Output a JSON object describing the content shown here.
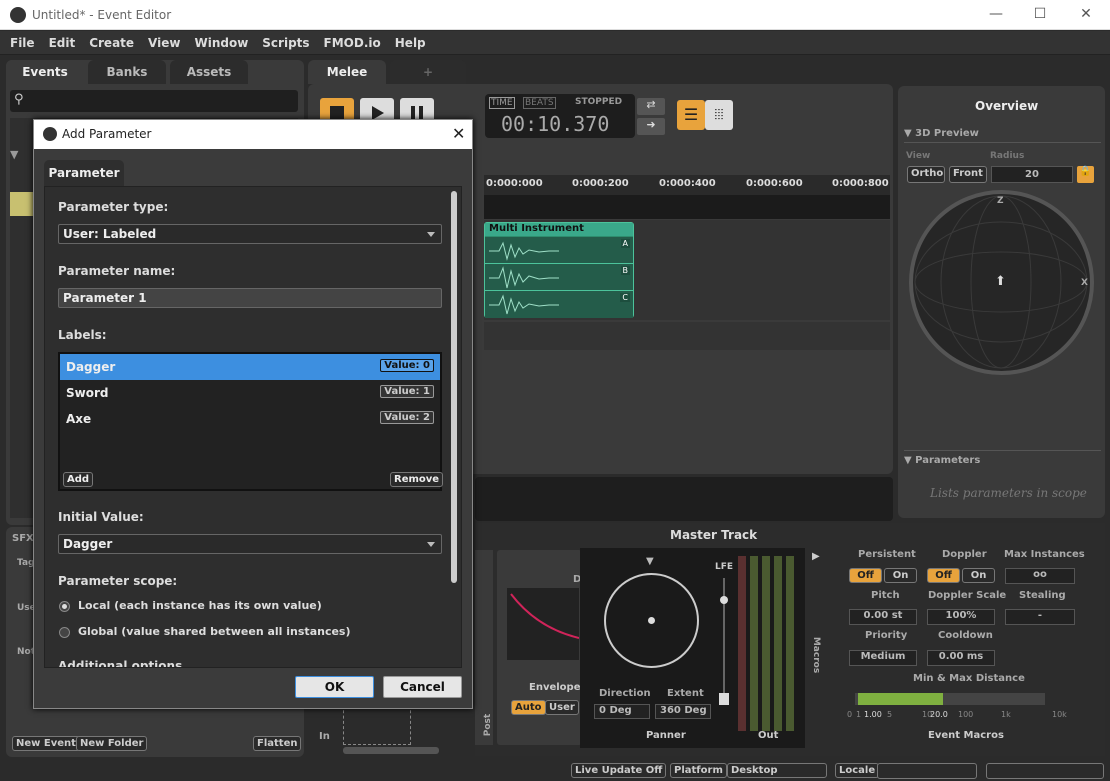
{
  "window": {
    "title": "Untitled* - Event Editor",
    "min": "—",
    "max": "☐",
    "close": "✕"
  },
  "menu": [
    "File",
    "Edit",
    "Create",
    "View",
    "Window",
    "Scripts",
    "FMOD.io",
    "Help"
  ],
  "browser": {
    "tabs": [
      "Events",
      "Banks",
      "Assets"
    ],
    "bottom_buttons": {
      "new_event": "New Event",
      "new_folder": "New Folder",
      "flatten": "Flatten"
    },
    "deck_fragments": {
      "sfx": "SFX/",
      "tag": "Tag",
      "use": "Use",
      "not": "Not"
    }
  },
  "editor": {
    "tabs": [
      "Melee",
      "+"
    ],
    "transport": {
      "time_label": "TIME",
      "beats_label": "BEATS",
      "state": "STOPPED",
      "time": "00:10.370"
    },
    "ruler": [
      "0:000:000",
      "0:000:200",
      "0:000:400",
      "0:000:600",
      "0:000:800"
    ],
    "instrument": {
      "name": "Multi Instrument",
      "playlist": [
        "A",
        "B",
        "C"
      ]
    }
  },
  "overview": {
    "title": "Overview",
    "preview_section": "3D Preview",
    "view_label": "View",
    "radius_label": "Radius",
    "view_buttons": [
      "Ortho",
      "Front"
    ],
    "radius": "20",
    "axis_z": "Z",
    "axis_x": "X",
    "parameters_section": "Parameters",
    "parameters_hint": "Lists parameters in scope"
  },
  "master": {
    "title": "Master Track",
    "effect_fragment": "D",
    "envelope_label": "Envelope",
    "auto": "Auto",
    "user": "User",
    "in_label": "In",
    "post_label": "Post",
    "lfe": "LFE",
    "direction_label": "Direction",
    "direction": "0 Deg",
    "extent_label": "Extent",
    "extent": "360 Deg",
    "panner": "Panner",
    "out": "Out",
    "macros_vertical": "Macros"
  },
  "macros": {
    "persistent": "Persistent",
    "doppler": "Doppler",
    "max_instances": "Max Instances",
    "off": "Off",
    "on": "On",
    "max_instances_value": "oo",
    "pitch": "Pitch",
    "pitch_value": "0.00 st",
    "doppler_scale": "Doppler Scale",
    "doppler_scale_value": "100%",
    "stealing": "Stealing",
    "stealing_value": "-",
    "priority": "Priority",
    "priority_value": "Medium",
    "cooldown": "Cooldown",
    "cooldown_value": "0.00 ms",
    "min_max": "Min & Max Distance",
    "min_value": "1.00",
    "max_value": "20.0",
    "scale": [
      "0",
      "1",
      "5",
      "10",
      "100",
      "1k",
      "10k"
    ],
    "footer": "Event Macros"
  },
  "statusbar": {
    "live_update": "Live Update Off",
    "platform_label": "Platform",
    "platform": "Desktop",
    "locale_label": "Locale"
  },
  "dialog": {
    "title": "Add Parameter",
    "tab": "Parameter",
    "type_label": "Parameter type:",
    "type_value": "User: Labeled",
    "name_label": "Parameter name:",
    "name_value": "Parameter 1",
    "labels_label": "Labels:",
    "labels": [
      {
        "name": "Dagger",
        "value": "Value: 0",
        "selected": true
      },
      {
        "name": "Sword",
        "value": "Value: 1",
        "selected": false
      },
      {
        "name": "Axe",
        "value": "Value: 2",
        "selected": false
      }
    ],
    "add": "Add",
    "remove": "Remove",
    "initial_label": "Initial Value:",
    "initial_value": "Dagger",
    "scope_label": "Parameter scope:",
    "scope_local": "Local (each instance has its own value)",
    "scope_global": "Global (value shared between all instances)",
    "scope_selected": "local",
    "additional_fragment": "Additional options",
    "ok": "OK",
    "cancel": "Cancel"
  },
  "colors": {
    "accent": "#e8a33c",
    "selection": "#3d8fe0",
    "instrument": "#3aa88a",
    "meter": "#5a8a30"
  }
}
